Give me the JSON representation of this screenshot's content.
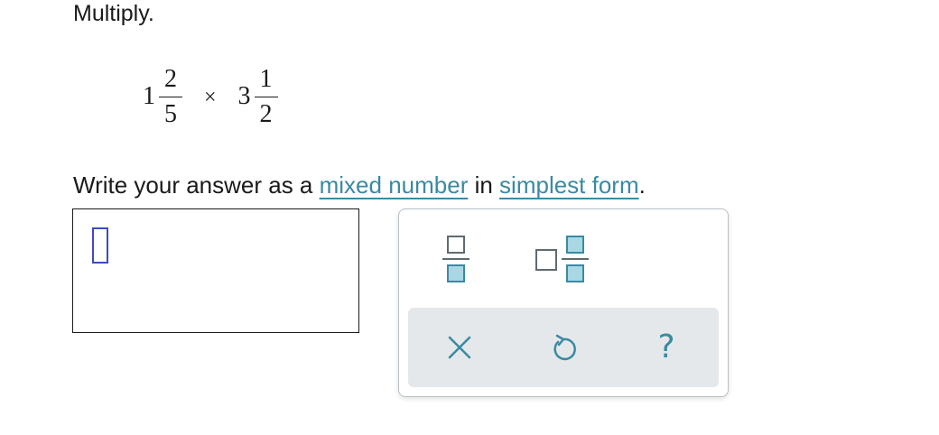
{
  "instruction": "Multiply.",
  "expression": {
    "left": {
      "whole": "1",
      "numerator": "2",
      "denominator": "5"
    },
    "operator": "×",
    "right": {
      "whole": "3",
      "numerator": "1",
      "denominator": "2"
    }
  },
  "prompt": {
    "before": "Write your answer as a ",
    "link1": "mixed number",
    "middle": " in ",
    "link2": "simplest form",
    "after": "."
  },
  "answer": {
    "value": ""
  },
  "toolbox": {
    "tools": [
      {
        "name": "fraction-template",
        "icon": "fraction-icon"
      },
      {
        "name": "mixed-number-template",
        "icon": "mixed-number-icon"
      }
    ],
    "actions": [
      {
        "name": "clear",
        "icon": "close-icon"
      },
      {
        "name": "undo",
        "icon": "undo-icon"
      },
      {
        "name": "help",
        "icon": "help-icon",
        "glyph": "?"
      }
    ]
  },
  "colors": {
    "link": "#3a8aa1",
    "icon_teal": "#3a8aa1",
    "cursor_blue": "#3b4bc8",
    "toolbar_bg": "#e4e8ea",
    "panel_border": "#b9c1c6"
  }
}
